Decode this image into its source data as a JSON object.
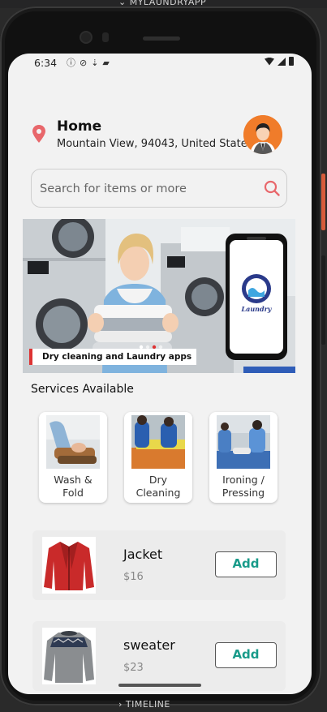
{
  "editor": {
    "top_label": "MYLAUNDRYAPP",
    "bottom_label": "TIMELINE"
  },
  "status_bar": {
    "time": "6:34"
  },
  "location": {
    "title": "Home",
    "address": "Mountain View, 94043, United States"
  },
  "search": {
    "placeholder": "Search for items or more"
  },
  "banner": {
    "caption": "Dry cleaning and Laundry apps",
    "phone_logo_text": "Laundry"
  },
  "services": {
    "title": "Services Available",
    "items": [
      {
        "line1": "Wash &",
        "line2": "Fold"
      },
      {
        "line1": "Dry",
        "line2": "Cleaning"
      },
      {
        "line1": "Ironing /",
        "line2": "Pressing"
      }
    ]
  },
  "products": [
    {
      "name": "Jacket",
      "price": "$16",
      "button": "Add"
    },
    {
      "name": "sweater",
      "price": "$23",
      "button": "Add"
    }
  ],
  "colors": {
    "accent": "#199b8a",
    "pin": "#e8676b",
    "avatar_bg": "#f07c2a",
    "search_icon": "#e8676b"
  }
}
